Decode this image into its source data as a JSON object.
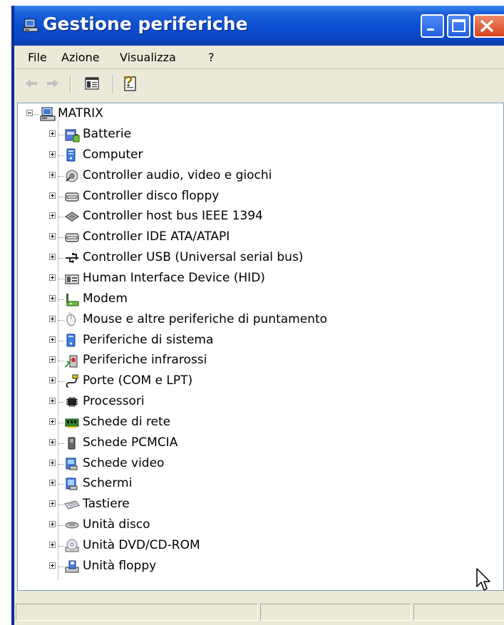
{
  "window": {
    "title": "Gestione periferiche"
  },
  "menu": {
    "items": [
      "File",
      "Azione",
      "Visualizza",
      "?"
    ]
  },
  "tree": {
    "root": {
      "label": "MATRIX",
      "icon": "computer-icon"
    },
    "items": [
      {
        "label": "Batterie",
        "icon": "battery-icon"
      },
      {
        "label": "Computer",
        "icon": "computer-icon"
      },
      {
        "label": "Controller audio, video e giochi",
        "icon": "speaker-icon"
      },
      {
        "label": "Controller disco floppy",
        "icon": "disk-controller-icon"
      },
      {
        "label": "Controller host bus IEEE 1394",
        "icon": "ieee1394-icon"
      },
      {
        "label": "Controller IDE ATA/ATAPI",
        "icon": "disk-controller-icon"
      },
      {
        "label": "Controller USB (Universal serial bus)",
        "icon": "usb-icon"
      },
      {
        "label": "Human Interface Device (HID)",
        "icon": "hid-icon"
      },
      {
        "label": "Modem",
        "icon": "modem-icon"
      },
      {
        "label": "Mouse e altre periferiche di puntamento",
        "icon": "mouse-icon"
      },
      {
        "label": "Periferiche di sistema",
        "icon": "system-device-icon"
      },
      {
        "label": "Periferiche infrarossi",
        "icon": "infrared-icon"
      },
      {
        "label": "Porte (COM e LPT)",
        "icon": "port-icon"
      },
      {
        "label": "Processori",
        "icon": "processor-icon"
      },
      {
        "label": "Schede di rete",
        "icon": "network-card-icon"
      },
      {
        "label": "Schede PCMCIA",
        "icon": "pcmcia-icon"
      },
      {
        "label": "Schede video",
        "icon": "display-adapter-icon"
      },
      {
        "label": "Schermi",
        "icon": "monitor-icon"
      },
      {
        "label": "Tastiere",
        "icon": "keyboard-icon"
      },
      {
        "label": "Unità disco",
        "icon": "disk-drive-icon"
      },
      {
        "label": "Unità DVD/CD-ROM",
        "icon": "cdrom-icon"
      },
      {
        "label": "Unità floppy",
        "icon": "floppy-icon"
      }
    ]
  },
  "colors": {
    "titlebar": "#0b4fd0",
    "client": "#ece9d8",
    "close_button": "#d8421c"
  }
}
